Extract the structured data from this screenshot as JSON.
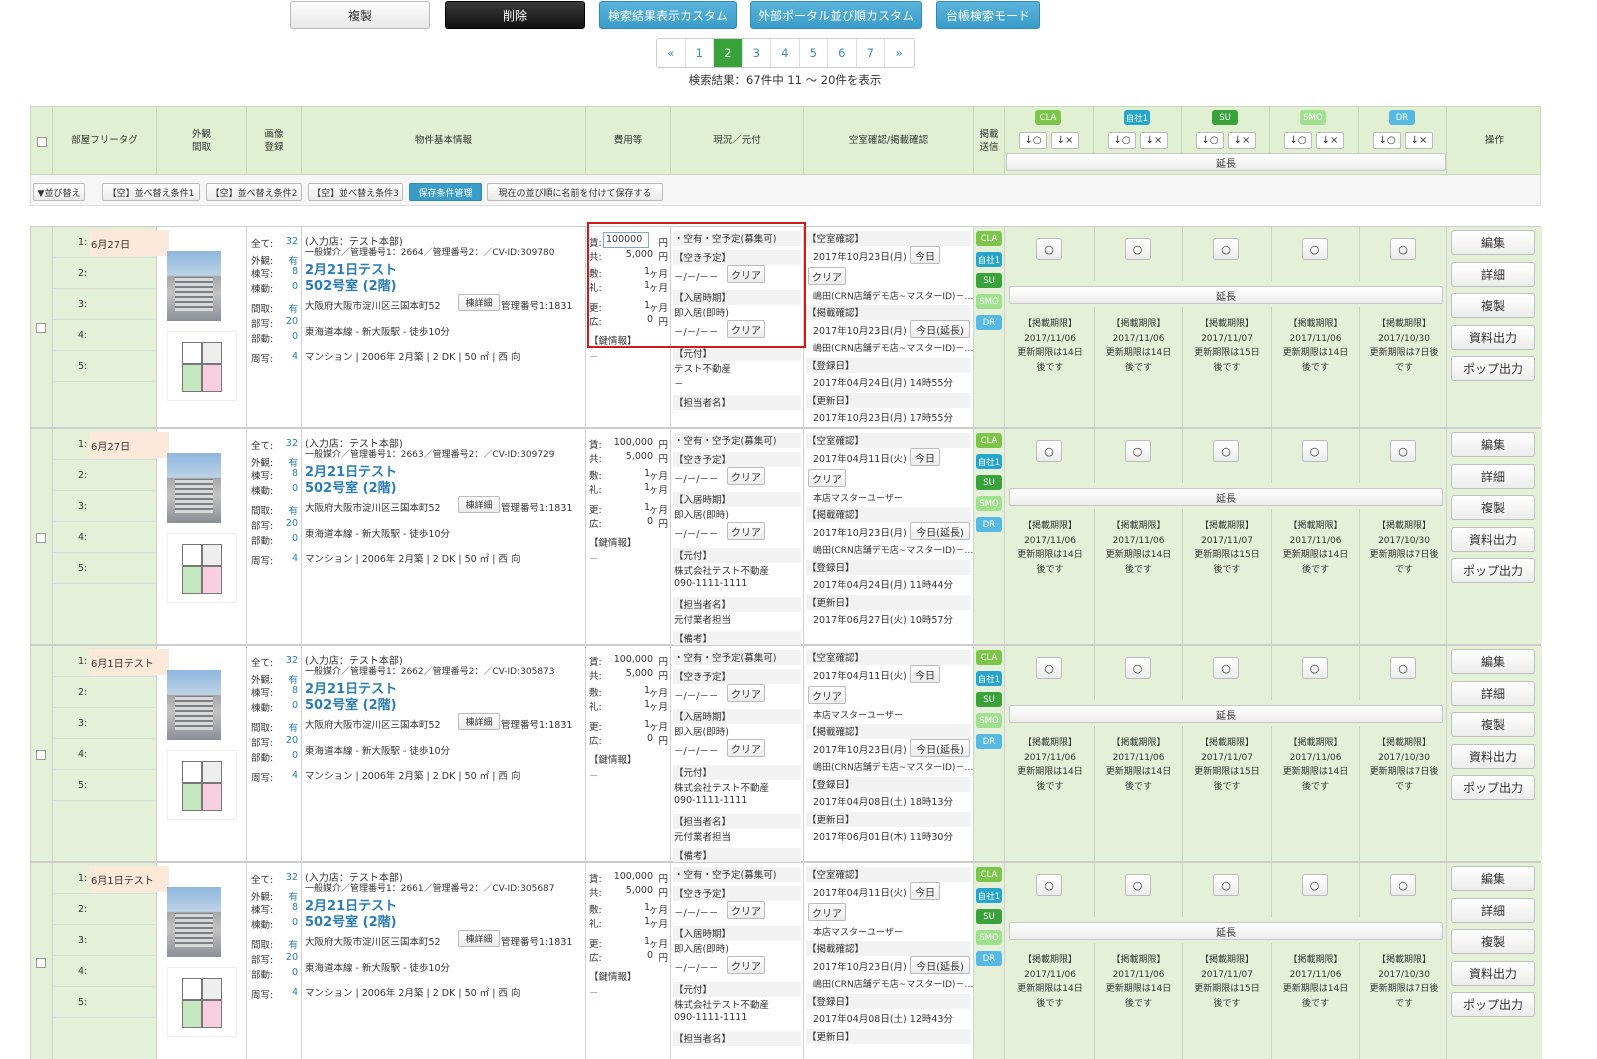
{
  "toolbar": {
    "copy": "複製",
    "delete": "削除",
    "custom_search_display": "検索結果表示カスタム",
    "custom_portal_order": "外部ポータル並び順カスタム",
    "ledger_mode": "台帳検索モード"
  },
  "pager": {
    "prev": "«",
    "next": "»",
    "pages": [
      "1",
      "2",
      "3",
      "4",
      "5",
      "6",
      "7"
    ],
    "current": "2",
    "summary": "検索結果：67件中 11 〜 20件を表示"
  },
  "header": {
    "room_tag": "部屋フリータグ",
    "exterior": "外観\n間取",
    "image_reg": "画像\n登録",
    "basic_info": "物件基本情報",
    "cost": "費用等",
    "status": "現況／元付",
    "vacancy_check": "空室確認/掲載確認",
    "post_send": "掲載\n送信",
    "operations": "操作",
    "extend": "延長",
    "sort_up": "↓○",
    "sort_down": "↓×",
    "portals": [
      {
        "name": "CLA",
        "color": "#7cc44a"
      },
      {
        "name": "自社1",
        "color": "#25a5c9"
      },
      {
        "name": "SU",
        "color": "#3aa23a"
      },
      {
        "name": "SMO",
        "color": "#9fe08f"
      },
      {
        "name": "DR",
        "color": "#56b9e4"
      }
    ]
  },
  "sortbar": {
    "toggle": "▼並び替え",
    "cond1": "【空】並べ替え条件1",
    "cond2": "【空】並べ替え条件2",
    "cond3": "【空】並べ替え条件3",
    "saved": "保存条件管理",
    "save_name": "現在の並び順に名前を付けて保存する"
  },
  "labels": {
    "all": "全て:",
    "exterior": "外観:",
    "building": "棟写:",
    "building_video": "棟動:",
    "layout": "間取:",
    "room": "部写:",
    "room_video": "部動:",
    "surround": "周写:",
    "rent": "賃:",
    "common": "共:",
    "deposit": "敷:",
    "key_money": "礼:",
    "renewal": "更:",
    "ad": "広:",
    "key_info": "【鍵情報】",
    "vacancy_plan": "【空き予定】",
    "move_in": "【入居時期】",
    "origin": "【元付】",
    "person": "【担当者名】",
    "remarks": "【備考】",
    "vacancy_check": "【空室確認】",
    "post_check": "【掲載確認】",
    "registered": "【登録日】",
    "updated": "【更新日】",
    "today": "今日",
    "today_extend": "今日(延長)",
    "clear": "クリア",
    "detail_btn": "棟詳細",
    "yen": "円",
    "month": "ヶ月",
    "post_limit": "【掲載期限】",
    "ops": [
      "編集",
      "詳細",
      "複製",
      "資料出力",
      "ポップ出力"
    ],
    "tag_nums": [
      "1:",
      "2:",
      "3:",
      "4:",
      "5:"
    ]
  },
  "rows": [
    {
      "tag": "6月27日",
      "counts": {
        "all": "32",
        "exterior": "有",
        "building": "8",
        "building_video": "0",
        "layout": "有",
        "room": "20",
        "room_video": "0",
        "surround": "4"
      },
      "store": "(入力店：テスト本部)",
      "ids": "一般媒介／管理番号1：2664／管理番号2：／CV-ID:309780",
      "title1": "2月21日テスト",
      "title2": "502号室 (2階)",
      "address": "大阪府大阪市淀川区三国本町52",
      "mgmt": "管理番号1:1831",
      "station": "東海道本線 - 新大阪駅 - 徒歩10分",
      "spec": "マンション | 2006年 2月築 | 2 DK | 50 ㎡ | 西 向",
      "rent": "100000",
      "common": "5,000",
      "deposit": "1",
      "key_money": "1",
      "renewal": "1",
      "ad": "0",
      "key_val": "－",
      "status": "・空有・空予定(募集可)",
      "vacancy_plan": "－/－/－－",
      "move_in_val": "即入居(即時)",
      "move_in_date": "－/－/－－",
      "origin": "テスト不動産",
      "origin_tel": "－",
      "person": "",
      "vac_date": "2017年10月23日(月)",
      "vac_person": "嶋田(CRN店舗デモ店~マスターID)－…",
      "post_date": "2017年10月23日(月)",
      "post_person": "嶋田(CRN店舗デモ店~マスターID)－…",
      "reg_date": "2017年04月24日(月) 14時55分",
      "upd_date": "2017年10月23日(月) 17時55分",
      "limits": [
        {
          "date": "2017/11/06",
          "msg": "更新期限は14日",
          "msg2": "後です"
        },
        {
          "date": "2017/11/06",
          "msg": "更新期限は14日",
          "msg2": "後です"
        },
        {
          "date": "2017/11/07",
          "msg": "更新期限は15日",
          "msg2": "後です"
        },
        {
          "date": "2017/11/06",
          "msg": "更新期限は14日",
          "msg2": "後です"
        },
        {
          "date": "2017/10/30",
          "msg": "更新期限は7日後",
          "msg2": "です"
        }
      ]
    },
    {
      "tag": "6月27日",
      "counts": {
        "all": "32",
        "exterior": "有",
        "building": "8",
        "building_video": "0",
        "layout": "有",
        "room": "20",
        "room_video": "0",
        "surround": "4"
      },
      "store": "(入力店：テスト本部)",
      "ids": "一般媒介／管理番号1：2663／管理番号2：／CV-ID:309729",
      "title1": "2月21日テスト",
      "title2": "502号室 (2階)",
      "address": "大阪府大阪市淀川区三国本町52",
      "mgmt": "管理番号1:1831",
      "station": "東海道本線 - 新大阪駅 - 徒歩10分",
      "spec": "マンション | 2006年 2月築 | 2 DK | 50 ㎡ | 西 向",
      "rent": "100,000",
      "common": "5,000",
      "deposit": "1",
      "key_money": "1",
      "renewal": "1",
      "ad": "0",
      "key_val": "－",
      "status": "・空有・空予定(募集可)",
      "vacancy_plan": "－/－/－－",
      "move_in_val": "即入居(即時)",
      "move_in_date": "－/－/－－",
      "origin": "株式会社テスト不動産",
      "origin_tel": "090-1111-1111",
      "person": "元付業者担当",
      "vac_date": "2017年04月11日(火)",
      "vac_person": "本店マスターユーザー",
      "post_date": "2017年10月23日(月)",
      "post_person": "嶋田(CRN店舗デモ店~マスターID)－…",
      "reg_date": "2017年04月24日(月) 11時44分",
      "upd_date": "2017年06月27日(火) 10時57分",
      "limits": [
        {
          "date": "2017/11/06",
          "msg": "更新期限は14日",
          "msg2": "後です"
        },
        {
          "date": "2017/11/06",
          "msg": "更新期限は14日",
          "msg2": "後です"
        },
        {
          "date": "2017/11/07",
          "msg": "更新期限は15日",
          "msg2": "後です"
        },
        {
          "date": "2017/11/06",
          "msg": "更新期限は14日",
          "msg2": "後です"
        },
        {
          "date": "2017/10/30",
          "msg": "更新期限は7日後",
          "msg2": "です"
        }
      ]
    },
    {
      "tag": "6月1日テスト",
      "counts": {
        "all": "32",
        "exterior": "有",
        "building": "8",
        "building_video": "0",
        "layout": "有",
        "room": "20",
        "room_video": "0",
        "surround": "4"
      },
      "store": "(入力店：テスト本部)",
      "ids": "一般媒介／管理番号1：2662／管理番号2：／CV-ID:305873",
      "title1": "2月21日テスト",
      "title2": "502号室 (2階)",
      "address": "大阪府大阪市淀川区三国本町52",
      "mgmt": "管理番号1:1831",
      "station": "東海道本線 - 新大阪駅 - 徒歩10分",
      "spec": "マンション | 2006年 2月築 | 2 DK | 50 ㎡ | 西 向",
      "rent": "100,000",
      "common": "5,000",
      "deposit": "1",
      "key_money": "1",
      "renewal": "1",
      "ad": "0",
      "key_val": "－",
      "status": "・空有・空予定(募集可)",
      "vacancy_plan": "－/－/－－",
      "move_in_val": "即入居(即時)",
      "move_in_date": "－/－/－－",
      "origin": "株式会社テスト不動産",
      "origin_tel": "090-1111-1111",
      "person": "元付業者担当",
      "vac_date": "2017年04月11日(火)",
      "vac_person": "本店マスターユーザー",
      "post_date": "2017年10月23日(月)",
      "post_person": "嶋田(CRN店舗デモ店~マスターID)－…",
      "reg_date": "2017年04月08日(土) 18時13分",
      "upd_date": "2017年06月01日(木) 11時30分",
      "limits": [
        {
          "date": "2017/11/06",
          "msg": "更新期限は14日",
          "msg2": "後です"
        },
        {
          "date": "2017/11/06",
          "msg": "更新期限は14日",
          "msg2": "後です"
        },
        {
          "date": "2017/11/07",
          "msg": "更新期限は15日",
          "msg2": "後です"
        },
        {
          "date": "2017/11/06",
          "msg": "更新期限は14日",
          "msg2": "後です"
        },
        {
          "date": "2017/10/30",
          "msg": "更新期限は7日後",
          "msg2": "です"
        }
      ]
    },
    {
      "tag": "6月1日テスト",
      "counts": {
        "all": "32",
        "exterior": "有",
        "building": "8",
        "building_video": "0",
        "layout": "有",
        "room": "20",
        "room_video": "0",
        "surround": "4"
      },
      "store": "(入力店：テスト本部)",
      "ids": "一般媒介／管理番号1：2661／管理番号2：／CV-ID:305687",
      "title1": "2月21日テスト",
      "title2": "502号室 (2階)",
      "address": "大阪府大阪市淀川区三国本町52",
      "mgmt": "管理番号1:1831",
      "station": "東海道本線 - 新大阪駅 - 徒歩10分",
      "spec": "マンション | 2006年 2月築 | 2 DK | 50 ㎡ | 西 向",
      "rent": "100,000",
      "common": "5,000",
      "deposit": "1",
      "key_money": "1",
      "renewal": "1",
      "ad": "0",
      "key_val": "－",
      "status": "・空有・空予定(募集可)",
      "vacancy_plan": "－/－/－－",
      "move_in_val": "即入居(即時)",
      "move_in_date": "－/－/－－",
      "origin": "株式会社テスト不動産",
      "origin_tel": "090-1111-1111",
      "person": "",
      "vac_date": "2017年04月11日(火)",
      "vac_person": "本店マスターユーザー",
      "post_date": "2017年10月23日(月)",
      "post_person": "嶋田(CRN店舗デモ店~マスターID)－…",
      "reg_date": "2017年04月08日(土) 12時43分",
      "upd_date": "",
      "limits": [
        {
          "date": "2017/11/06",
          "msg": "更新期限は14日",
          "msg2": "後です"
        },
        {
          "date": "2017/11/06",
          "msg": "更新期限は14日",
          "msg2": "後です"
        },
        {
          "date": "2017/11/07",
          "msg": "更新期限は15日",
          "msg2": "後です"
        },
        {
          "date": "2017/11/06",
          "msg": "更新期限は14日",
          "msg2": "後です"
        },
        {
          "date": "2017/10/30",
          "msg": "更新期限は7日後",
          "msg2": "です"
        }
      ]
    }
  ]
}
